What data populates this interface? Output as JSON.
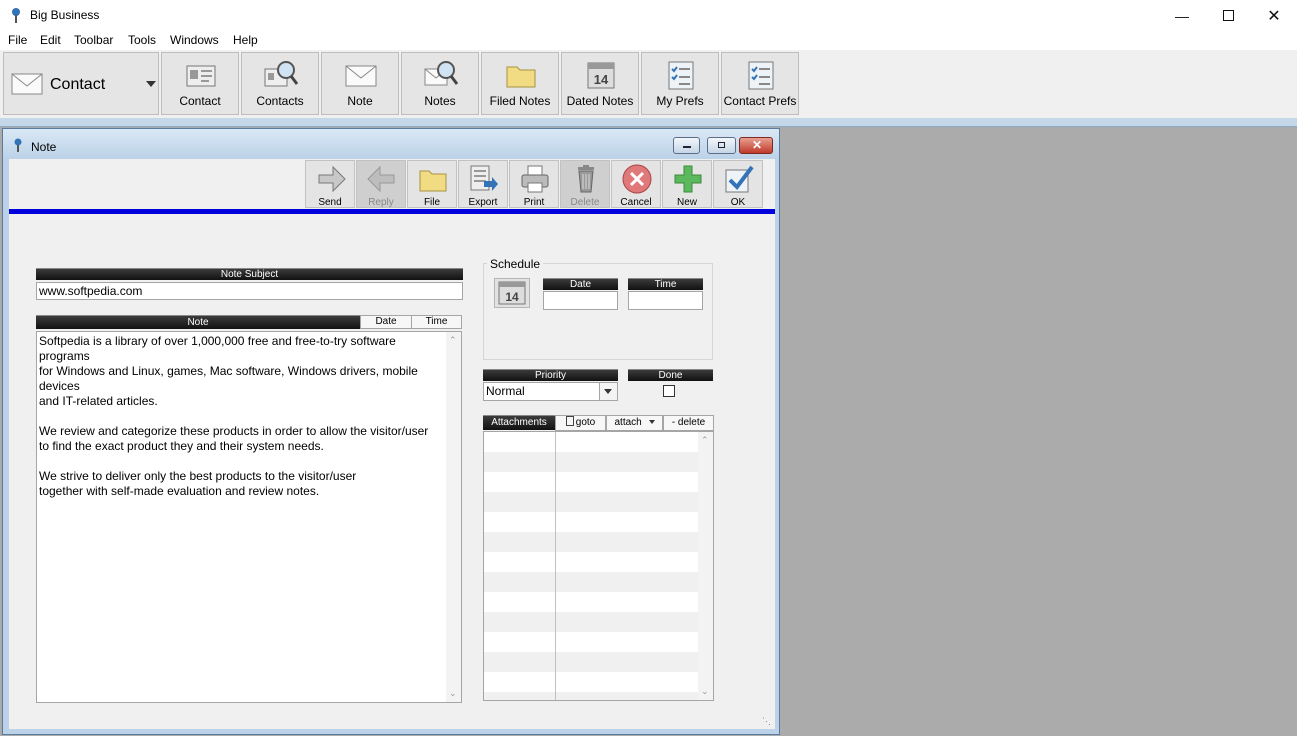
{
  "window": {
    "title": "Big Business"
  },
  "menu": [
    "File",
    "Edit",
    "Toolbar",
    "Tools",
    "Windows",
    "Help"
  ],
  "toolbar": {
    "mode_label": "Contact",
    "buttons": [
      "Contact",
      "Contacts",
      "Note",
      "Notes",
      "Filed Notes",
      "Dated Notes",
      "My Prefs",
      "Contact Prefs"
    ]
  },
  "note_window": {
    "title": "Note",
    "toolbar": [
      {
        "label": "Send",
        "enabled": true
      },
      {
        "label": "Reply",
        "enabled": false
      },
      {
        "label": "File",
        "enabled": true
      },
      {
        "label": "Export",
        "enabled": true
      },
      {
        "label": "Print",
        "enabled": true
      },
      {
        "label": "Delete",
        "enabled": false
      },
      {
        "label": "Cancel",
        "enabled": true
      },
      {
        "label": "New",
        "enabled": true
      },
      {
        "label": "OK",
        "enabled": true
      }
    ],
    "subject_header": "Note Subject",
    "subject_value": "www.softpedia.com",
    "note_header": "Note",
    "date_col": "Date",
    "time_col": "Time",
    "note_text": "Softpedia is a library of over 1,000,000 free and free-to-try software programs\nfor Windows and Linux, games, Mac software, Windows drivers, mobile devices\nand IT-related articles.\n\nWe review and categorize these products in order to allow the visitor/user\nto find the exact product they and their system needs.\n\nWe strive to deliver only the best products to the visitor/user\ntogether with self-made evaluation and review notes.",
    "schedule": {
      "legend": "Schedule",
      "calendar_day": "14",
      "date_header": "Date",
      "time_header": "Time",
      "date_value": "",
      "time_value": ""
    },
    "priority": {
      "header": "Priority",
      "value": "Normal"
    },
    "done": {
      "header": "Done",
      "checked": false
    },
    "attachments": {
      "header": "Attachments",
      "goto": "goto",
      "attach": "attach",
      "delete": "- delete"
    }
  }
}
